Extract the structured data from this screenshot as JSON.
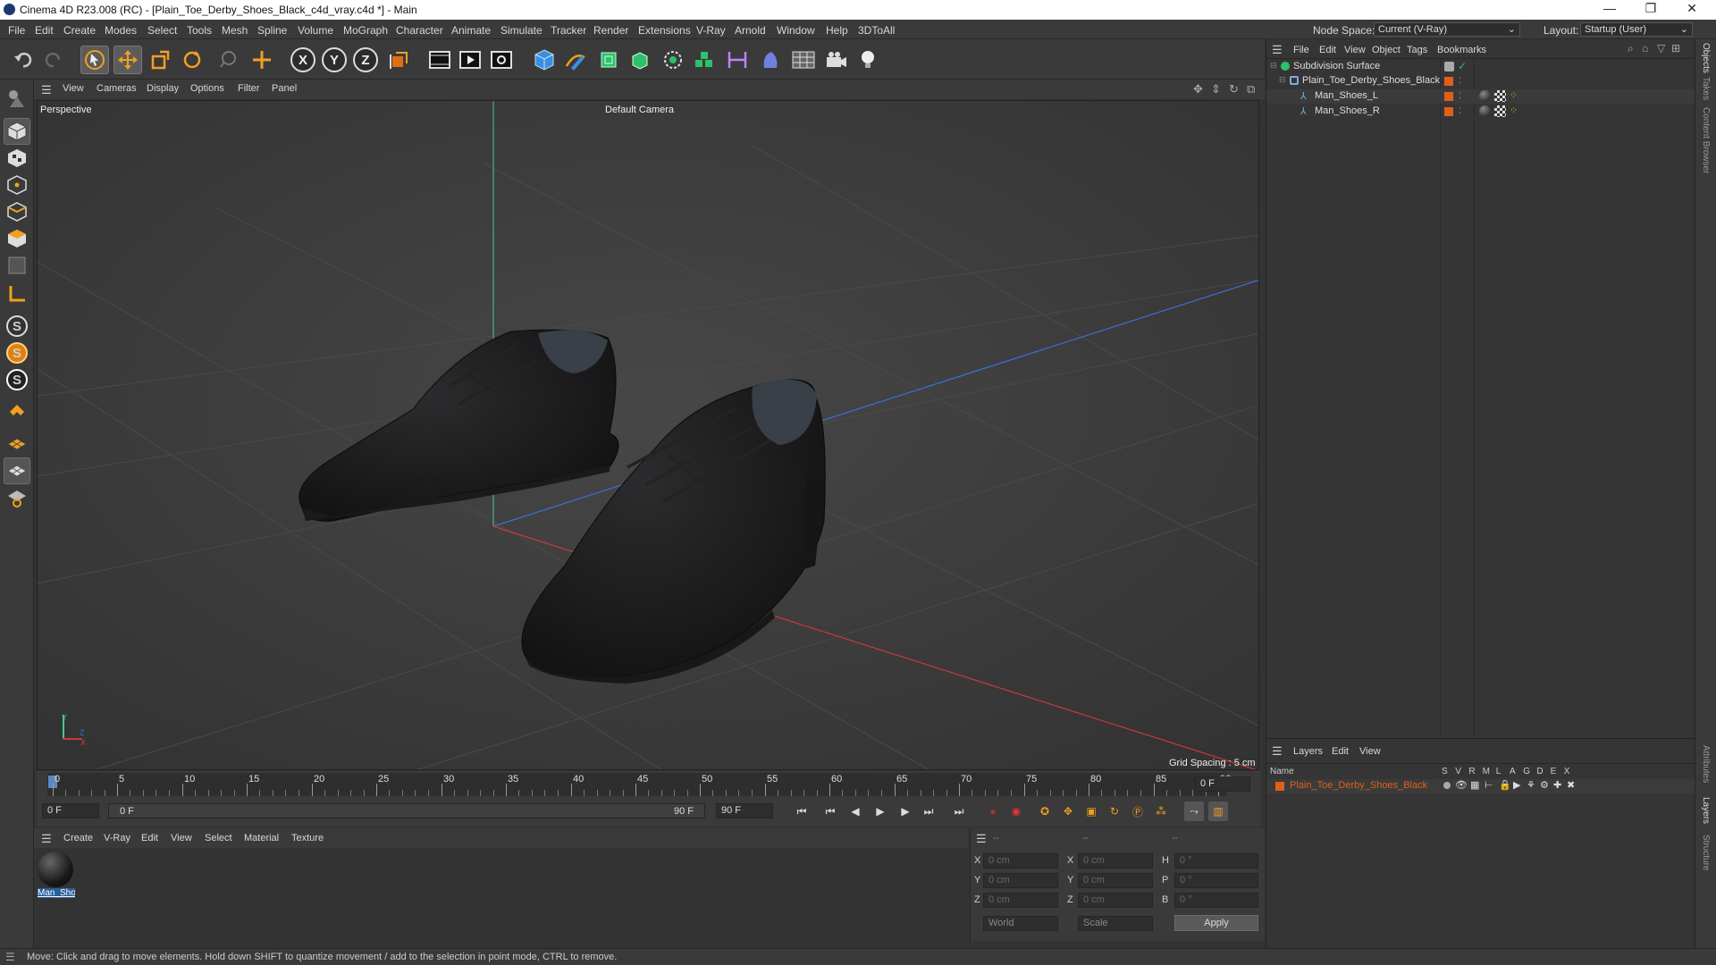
{
  "window": {
    "title": "Cinema 4D R23.008 (RC) - [Plain_Toe_Derby_Shoes_Black_c4d_vray.c4d *] - Main",
    "minimize": "—",
    "maximize": "❐",
    "close": "✕"
  },
  "menubar": {
    "items": [
      "File",
      "Edit",
      "Create",
      "Modes",
      "Select",
      "Tools",
      "Mesh",
      "Spline",
      "Volume",
      "MoGraph",
      "Character",
      "Animate",
      "Simulate",
      "Tracker",
      "Render",
      "Extensions",
      "V-Ray",
      "Arnold",
      "Window",
      "Help",
      "3DToAll"
    ],
    "node_space_label": "Node Space:",
    "node_space_value": "Current (V-Ray)",
    "layout_label": "Layout:",
    "layout_value": "Startup (User)"
  },
  "toolbar": {
    "icons": [
      "undo-icon",
      "redo-icon",
      "select-arrow-icon",
      "move-icon",
      "scale-icon",
      "rotate-icon",
      "select-tool-icon",
      "axis-icon",
      "x-axis-icon",
      "y-axis-icon",
      "z-axis-icon",
      "coordinate-system-icon",
      "render-view-icon",
      "render-icon",
      "render-settings-icon",
      "cube-icon",
      "pen-icon",
      "subdivision-icon",
      "extrude-icon",
      "array-icon",
      "cloner-icon",
      "symmetry-icon",
      "deformer-icon",
      "floor-icon",
      "camera-icon",
      "light-icon"
    ],
    "x_label": "X",
    "y_label": "Y",
    "z_label": "Z"
  },
  "viewport": {
    "menu": [
      "View",
      "Cameras",
      "Display",
      "Options",
      "Filter",
      "Panel"
    ],
    "label": "Perspective",
    "camera": "Default Camera",
    "grid_spacing": "Grid Spacing : 5 cm",
    "axis_x": "X",
    "axis_y": "Y",
    "axis_z": "Z"
  },
  "timeline": {
    "ticks": [
      "0",
      "5",
      "10",
      "15",
      "20",
      "25",
      "30",
      "35",
      "40",
      "45",
      "50",
      "55",
      "60",
      "65",
      "70",
      "75",
      "80",
      "85",
      "90"
    ],
    "current_frame": "0 F",
    "start_frame": "0 F",
    "range_start": "0 F",
    "range_end": "90 F",
    "end_frame": "90 F",
    "end_field": "0 F"
  },
  "material_manager": {
    "menu": [
      "Create",
      "V-Ray",
      "Edit",
      "View",
      "Select",
      "Material",
      "Texture"
    ],
    "materials": [
      {
        "name": "Man_Sho"
      }
    ]
  },
  "coordinates": {
    "header": [
      "--",
      "--",
      "--"
    ],
    "rows": [
      {
        "a": "X",
        "av": "0 cm",
        "b": "X",
        "bv": "0 cm",
        "c": "H",
        "cv": "0 °"
      },
      {
        "a": "Y",
        "av": "0 cm",
        "b": "Y",
        "bv": "0 cm",
        "c": "P",
        "cv": "0 °"
      },
      {
        "a": "Z",
        "av": "0 cm",
        "b": "Z",
        "bv": "0 cm",
        "c": "B",
        "cv": "0 °"
      }
    ],
    "mode": "World",
    "transform": "Scale",
    "apply": "Apply"
  },
  "object_manager": {
    "menu": [
      "File",
      "Edit",
      "View",
      "Object",
      "Tags",
      "Bookmarks"
    ],
    "objects": [
      {
        "name": "Subdivision Surface",
        "level": 0
      },
      {
        "name": "Plain_Toe_Derby_Shoes_Black",
        "level": 1
      },
      {
        "name": "Man_Shoes_L",
        "level": 2
      },
      {
        "name": "Man_Shoes_R",
        "level": 2
      }
    ]
  },
  "layer_manager": {
    "menu": [
      "Layers",
      "Edit",
      "View"
    ],
    "name_header": "Name",
    "columns": [
      "S",
      "V",
      "R",
      "M",
      "L",
      "A",
      "G",
      "D",
      "E",
      "X"
    ],
    "layers": [
      {
        "name": "Plain_Toe_Derby_Shoes_Black",
        "color": "#e0601a"
      }
    ]
  },
  "right_tabs": [
    "Objects",
    "Takes",
    "Content Browser",
    "Attributes",
    "Layers",
    "Structure"
  ],
  "status": "Move: Click and drag to move elements. Hold down SHIFT to quantize movement / add to the selection in point mode, CTRL to remove.",
  "colors": {
    "accent": "#e0601a",
    "bg": "#333333",
    "x_axis": "#c83a3a",
    "y_axis": "#4ec38a",
    "z_axis": "#3a6fd8"
  }
}
